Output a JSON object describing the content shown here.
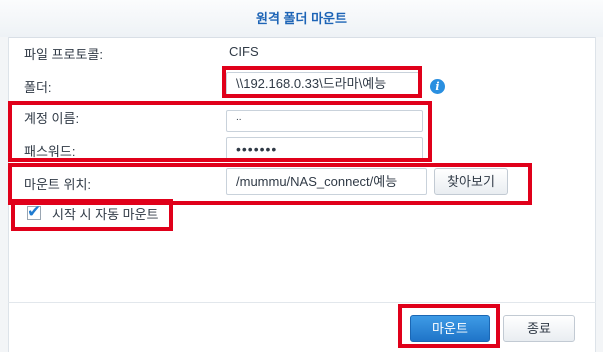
{
  "dialog": {
    "title": "원격 폴더 마운트"
  },
  "form": {
    "protocol_label": "파일 프로토콜:",
    "protocol_value": "CIFS",
    "folder_label": "폴더:",
    "folder_value": "\\\\192.168.0.33\\드라마\\예능",
    "account_label": "계정 이름:",
    "account_value": "..",
    "password_label": "패스워드:",
    "password_value": "•••••••",
    "mount_point_label": "마운트 위치:",
    "mount_point_value": "/mummu/NAS_connect/예능",
    "browse_label": "찾아보기",
    "automount_label": "시작 시 자동 마운트",
    "automount_checked": true
  },
  "footer": {
    "mount_label": "마운트",
    "close_label": "종료"
  },
  "colors": {
    "accent": "#1f74c8",
    "title": "#1d64b6",
    "annotation": "#e0001a"
  },
  "icons": {
    "info": "info-icon",
    "check": "checkmark-icon"
  }
}
